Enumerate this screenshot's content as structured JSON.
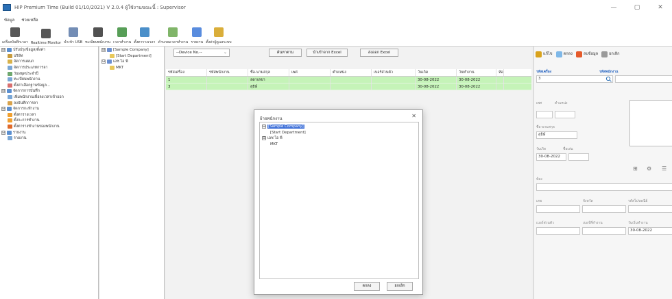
{
  "window": {
    "title": "HIP Premium Time (Build 01/10/2021) V 2.0.4  ผู้ใช้งานขณะนี้ : Supervisor",
    "minimize": "—",
    "restore": "▢",
    "close": "✕"
  },
  "menu": [
    "ข้อมูล",
    "ช่วยเหลือ"
  ],
  "toolbar": [
    {
      "label": "เครื่องบันทึกเวลา",
      "icon": "time-clock-icon",
      "color": "#3a3a3a"
    },
    {
      "label": "Realtime Monitor",
      "icon": "monitor-icon",
      "color": "#3a3a3a"
    },
    {
      "label": "นำเข้า USB",
      "icon": "usb-icon",
      "color": "#5a79a8"
    },
    {
      "label": "ทะเบียนพนักงาน",
      "icon": "employee-icon",
      "color": "#333"
    },
    {
      "label": "เวลาทำงาน",
      "icon": "clock-icon",
      "color": "#3a8d3a"
    },
    {
      "label": "ตั้งตารางเวลา",
      "icon": "calendar-icon",
      "color": "#2b7bbf"
    },
    {
      "label": "คำนวณเวลาทำงาน",
      "icon": "calculate-icon",
      "color": "#6aa84f"
    },
    {
      "label": "รายงาน",
      "icon": "report-icon",
      "color": "#3c78d8"
    },
    {
      "label": "ตั้งค่าผู้ดูแลระบบ",
      "icon": "admin-settings-icon",
      "color": "#d4a017"
    }
  ],
  "nav_tree": [
    {
      "label": "ปรับปรุงข้อมูล/ตั้งค่า",
      "level": 0,
      "toggle": "⊟",
      "color": "#5b8fd0"
    },
    {
      "label": "บริษัท",
      "level": 1,
      "color": "#c89b3c"
    },
    {
      "label": "จัดการแผนก",
      "level": 1,
      "color": "#d8b24b"
    },
    {
      "label": "จัดการประเภทการลา",
      "level": 1,
      "color": "#7aa7d6"
    },
    {
      "label": "วันหยุดประจำปี",
      "level": 1,
      "color": "#6fa86f"
    },
    {
      "label": "ทะเบียนพนักงาน",
      "level": 1,
      "color": "#7aa7d6"
    },
    {
      "label": "ตั้งค่าเลือกฐานข้อมูล...",
      "level": 1,
      "color": "#d86f6f"
    },
    {
      "label": "จัดการการบันทึก",
      "level": 0,
      "toggle": "⊟",
      "color": "#5b8fd0"
    },
    {
      "label": "เพิ่มพนักงานเพื่อลงเวลาเข้าออก",
      "level": 1,
      "color": "#7aa7d6"
    },
    {
      "label": "ลงบันทึกการลา",
      "level": 1,
      "color": "#d8a24b"
    },
    {
      "label": "จัดการกะทำงาน",
      "level": 0,
      "toggle": "⊟",
      "color": "#5b8fd0"
    },
    {
      "label": "ตั้งตารางเวลา",
      "level": 1,
      "color": "#f0a030"
    },
    {
      "label": "ตั้งกะการทำงาน",
      "level": 1,
      "color": "#f0a030"
    },
    {
      "label": "ตั้งตารางทำงานของพนักงาน",
      "level": 1,
      "color": "#e06a2a"
    },
    {
      "label": "รายงาน",
      "level": 0,
      "toggle": "⊟",
      "color": "#5b8fd0"
    },
    {
      "label": "รายงาน",
      "level": 1,
      "color": "#7aa7d6"
    }
  ],
  "dept_tree": [
    {
      "label": "[Sample Company]",
      "level": 0,
      "toggle": "⊟"
    },
    {
      "label": "[Start Department]",
      "level": 1
    },
    {
      "label": "เอช ไอ พี",
      "level": 0,
      "toggle": "⊟"
    },
    {
      "label": "MKT",
      "level": 1
    }
  ],
  "main": {
    "device_placeholder": "--Device No.--",
    "device_chevron": "⌄",
    "buttons": {
      "refresh": "ค้นหาตาม",
      "import_excel": "นำเข้าจาก Excel",
      "export_excel": "ส่งออก Excel"
    },
    "columns": [
      "รหัสเครื่อง",
      "รหัสพนักงาน",
      "ชื่อ-นามสกุล",
      "เพศ",
      "ตำแหน่ง",
      "เบอร์ส่วนตัว",
      "วันเกิด",
      "วันทำงาน",
      "ห้อง"
    ],
    "rows": [
      [
        "1",
        "",
        "ลดาเลขา",
        "",
        "",
        "",
        "30-08-2022",
        "30-08-2022",
        ""
      ],
      [
        "3",
        "",
        "สุธิษ์",
        "",
        "",
        "",
        "30-08-2022",
        "30-08-2022",
        ""
      ]
    ],
    "row_color": "#c5f3b8"
  },
  "dialog": {
    "title": "ย้ายพนักงาน",
    "close": "✕",
    "tree": [
      {
        "label": "[Sample Company]",
        "level": 0,
        "toggle": "⊟",
        "selected": true
      },
      {
        "label": "[Start Department]",
        "level": 1
      },
      {
        "label": "เอช ไอ พี",
        "level": 0,
        "toggle": "⊟"
      },
      {
        "label": "MKT",
        "level": 1
      }
    ],
    "ok": "ตกลง",
    "cancel": "ยกเลิก",
    "selected_color": "#3d6fd8"
  },
  "right_panel": {
    "tools": [
      {
        "label": "แก้ไข",
        "icon": "edit-icon",
        "color": "#d9a21b"
      },
      {
        "label": "ตกลง",
        "icon": "check-icon",
        "color": "#7fb8e8"
      },
      {
        "label": "ลบข้อมูล",
        "icon": "delete-icon",
        "color": "#e55a2a"
      },
      {
        "label": "ยกเลิก",
        "icon": "cancel-icon",
        "color": "#9a9a9a"
      }
    ],
    "device_code_label": "รหัสเครื่อง",
    "device_code_value": "3",
    "employee_code_label": "รหัสพนักงาน",
    "gender_label": "เพศ",
    "position_label": "ตำแหน่ง",
    "name_label": "ชื่อ-นามสกุล",
    "name_value": "สุธิษ์",
    "birthday_label": "วันเกิด",
    "birthday_value": "30-08-2022",
    "nickname_label": "ชื่อเล่น",
    "room_label": "ห้อง",
    "address_label": "เลข",
    "province_label": "จังหวัด",
    "postcode_label": "รหัสไปรษณีย์",
    "phone_label": "เบอร์ส่วนตัว",
    "id_card_label": "เบอร์ที่ทำงาน",
    "start_date_label": "วันเริ่มทำงาน",
    "start_date_value": "30-08-2022",
    "search_icon": "search-icon",
    "calendar_glyph": "⊞"
  }
}
